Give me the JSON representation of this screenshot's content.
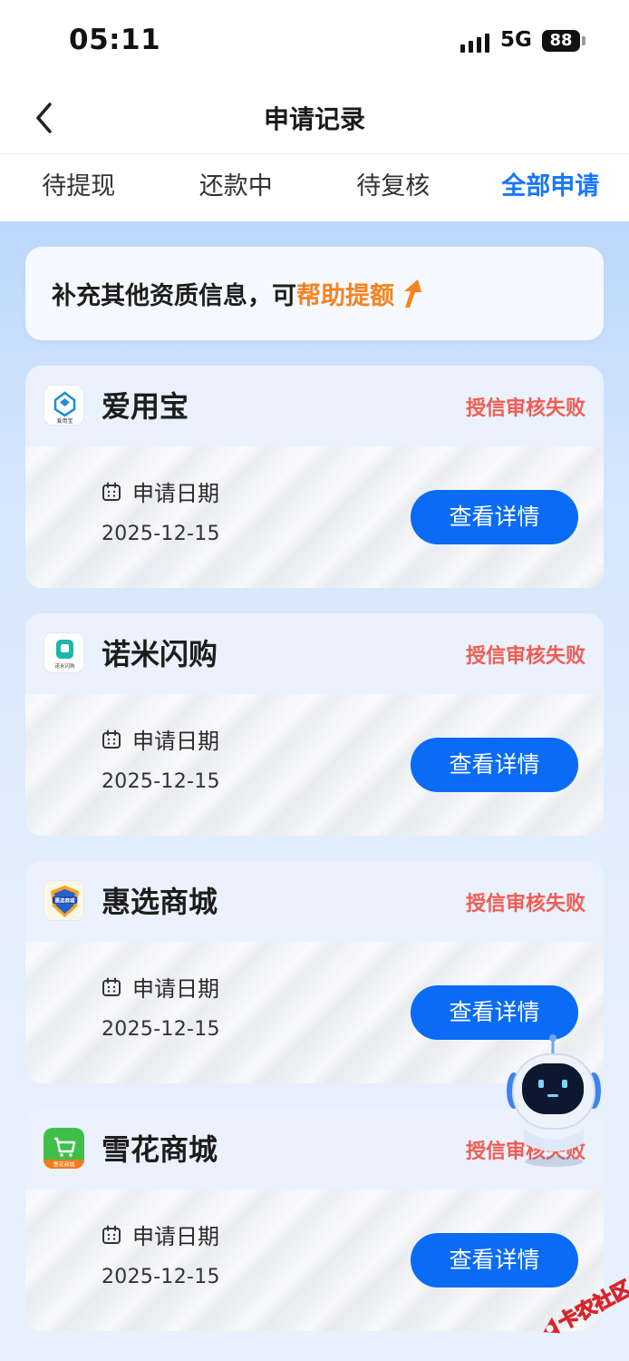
{
  "status_bar": {
    "time": "05:11",
    "network": "5G",
    "battery": "88"
  },
  "nav": {
    "title": "申请记录",
    "back_icon": "chevron-left-icon"
  },
  "tabs": [
    {
      "label": "待提现",
      "active": false
    },
    {
      "label": "还款中",
      "active": false
    },
    {
      "label": "待复核",
      "active": false
    },
    {
      "label": "全部申请",
      "active": true
    }
  ],
  "promo": {
    "text": "补充其他资质信息，可",
    "highlight": "帮助提额",
    "icon": "arrow-up-icon"
  },
  "records": [
    {
      "app_name": "爱用宝",
      "status": "授信审核失败",
      "date_label": "申请日期",
      "date": "2025-12-15",
      "button": "查看详情",
      "logo": "aiyongbao-logo",
      "logo_text": "爱用宝"
    },
    {
      "app_name": "诺米闪购",
      "status": "授信审核失败",
      "date_label": "申请日期",
      "date": "2025-12-15",
      "button": "查看详情",
      "logo": "nuomi-logo",
      "logo_text": "诺米闪购"
    },
    {
      "app_name": "惠选商城",
      "status": "授信审核失败",
      "date_label": "申请日期",
      "date": "2025-12-15",
      "button": "查看详情",
      "logo": "huixuan-logo",
      "logo_text": "惠选商城"
    },
    {
      "app_name": "雪花商城",
      "status": "授信审核失败",
      "date_label": "申请日期",
      "date": "2025-12-15",
      "button": "查看详情",
      "logo": "xuehua-logo",
      "logo_text": "雪花商城"
    }
  ],
  "watermark": "卡农社区",
  "colors": {
    "accent": "#1677ff",
    "button": "#0a6bf5",
    "status_fail": "#f05d52",
    "highlight": "#f5831f"
  }
}
